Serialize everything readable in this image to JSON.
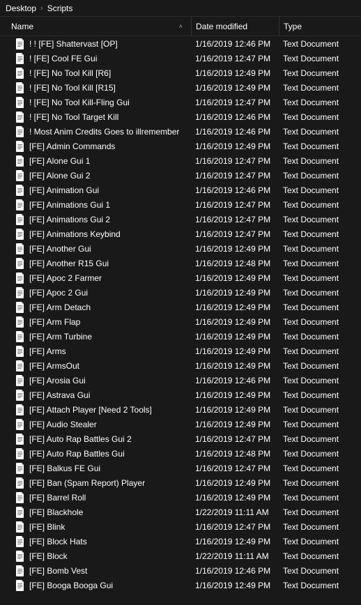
{
  "breadcrumb": {
    "items": [
      "Desktop",
      "Scripts"
    ]
  },
  "columns": {
    "name": "Name",
    "date": "Date modified",
    "type": "Type"
  },
  "files": [
    {
      "name": "! ! [FE] Shattervast [OP]",
      "date": "1/16/2019 12:46 PM",
      "type": "Text Document"
    },
    {
      "name": "! [FE] Cool FE Gui",
      "date": "1/16/2019 12:47 PM",
      "type": "Text Document"
    },
    {
      "name": "! [FE] No Tool Kill [R6]",
      "date": "1/16/2019 12:49 PM",
      "type": "Text Document"
    },
    {
      "name": "! [FE] No Tool Kill [R15]",
      "date": "1/16/2019 12:49 PM",
      "type": "Text Document"
    },
    {
      "name": "! [FE] No Tool Kill-Fling Gui",
      "date": "1/16/2019 12:47 PM",
      "type": "Text Document"
    },
    {
      "name": "! [FE] No Tool Target Kill",
      "date": "1/16/2019 12:46 PM",
      "type": "Text Document"
    },
    {
      "name": "! Most Anim Credits Goes to illremember",
      "date": "1/16/2019 12:46 PM",
      "type": "Text Document"
    },
    {
      "name": "[FE] Admin Commands",
      "date": "1/16/2019 12:49 PM",
      "type": "Text Document"
    },
    {
      "name": "[FE] Alone Gui 1",
      "date": "1/16/2019 12:47 PM",
      "type": "Text Document"
    },
    {
      "name": "[FE] Alone Gui 2",
      "date": "1/16/2019 12:47 PM",
      "type": "Text Document"
    },
    {
      "name": "[FE] Animation Gui",
      "date": "1/16/2019 12:46 PM",
      "type": "Text Document"
    },
    {
      "name": "[FE] Animations Gui 1",
      "date": "1/16/2019 12:47 PM",
      "type": "Text Document"
    },
    {
      "name": "[FE] Animations Gui 2",
      "date": "1/16/2019 12:47 PM",
      "type": "Text Document"
    },
    {
      "name": "[FE] Animations Keybind",
      "date": "1/16/2019 12:47 PM",
      "type": "Text Document"
    },
    {
      "name": "[FE] Another Gui",
      "date": "1/16/2019 12:49 PM",
      "type": "Text Document"
    },
    {
      "name": "[FE] Another R15 Gui",
      "date": "1/16/2019 12:48 PM",
      "type": "Text Document"
    },
    {
      "name": "[FE] Apoc 2 Farmer",
      "date": "1/16/2019 12:49 PM",
      "type": "Text Document"
    },
    {
      "name": "[FE] Apoc 2 Gui",
      "date": "1/16/2019 12:49 PM",
      "type": "Text Document"
    },
    {
      "name": "[FE] Arm Detach",
      "date": "1/16/2019 12:49 PM",
      "type": "Text Document"
    },
    {
      "name": "[FE] Arm Flap",
      "date": "1/16/2019 12:49 PM",
      "type": "Text Document"
    },
    {
      "name": "[FE] Arm Turbine",
      "date": "1/16/2019 12:49 PM",
      "type": "Text Document"
    },
    {
      "name": "[FE] Arms",
      "date": "1/16/2019 12:49 PM",
      "type": "Text Document"
    },
    {
      "name": "[FE] ArmsOut",
      "date": "1/16/2019 12:49 PM",
      "type": "Text Document"
    },
    {
      "name": "[FE] Arosia Gui",
      "date": "1/16/2019 12:46 PM",
      "type": "Text Document"
    },
    {
      "name": "[FE] Astrava Gui",
      "date": "1/16/2019 12:49 PM",
      "type": "Text Document"
    },
    {
      "name": "[FE] Attach Player [Need 2 Tools]",
      "date": "1/16/2019 12:49 PM",
      "type": "Text Document"
    },
    {
      "name": "[FE] Audio Stealer",
      "date": "1/16/2019 12:49 PM",
      "type": "Text Document"
    },
    {
      "name": "[FE] Auto Rap Battles Gui 2",
      "date": "1/16/2019 12:47 PM",
      "type": "Text Document"
    },
    {
      "name": "[FE] Auto Rap Battles Gui",
      "date": "1/16/2019 12:48 PM",
      "type": "Text Document"
    },
    {
      "name": "[FE] Balkus FE Gui",
      "date": "1/16/2019 12:47 PM",
      "type": "Text Document"
    },
    {
      "name": "[FE] Ban (Spam Report) Player",
      "date": "1/16/2019 12:49 PM",
      "type": "Text Document"
    },
    {
      "name": "[FE] Barrel Roll",
      "date": "1/16/2019 12:49 PM",
      "type": "Text Document"
    },
    {
      "name": "[FE] Blackhole",
      "date": "1/22/2019 11:11 AM",
      "type": "Text Document"
    },
    {
      "name": "[FE] Blink",
      "date": "1/16/2019 12:47 PM",
      "type": "Text Document"
    },
    {
      "name": "[FE] Block Hats",
      "date": "1/16/2019 12:49 PM",
      "type": "Text Document"
    },
    {
      "name": "[FE] Block",
      "date": "1/22/2019 11:11 AM",
      "type": "Text Document"
    },
    {
      "name": "[FE] Bomb Vest",
      "date": "1/16/2019 12:46 PM",
      "type": "Text Document"
    },
    {
      "name": "[FE] Booga Booga Gui",
      "date": "1/16/2019 12:49 PM",
      "type": "Text Document"
    }
  ]
}
